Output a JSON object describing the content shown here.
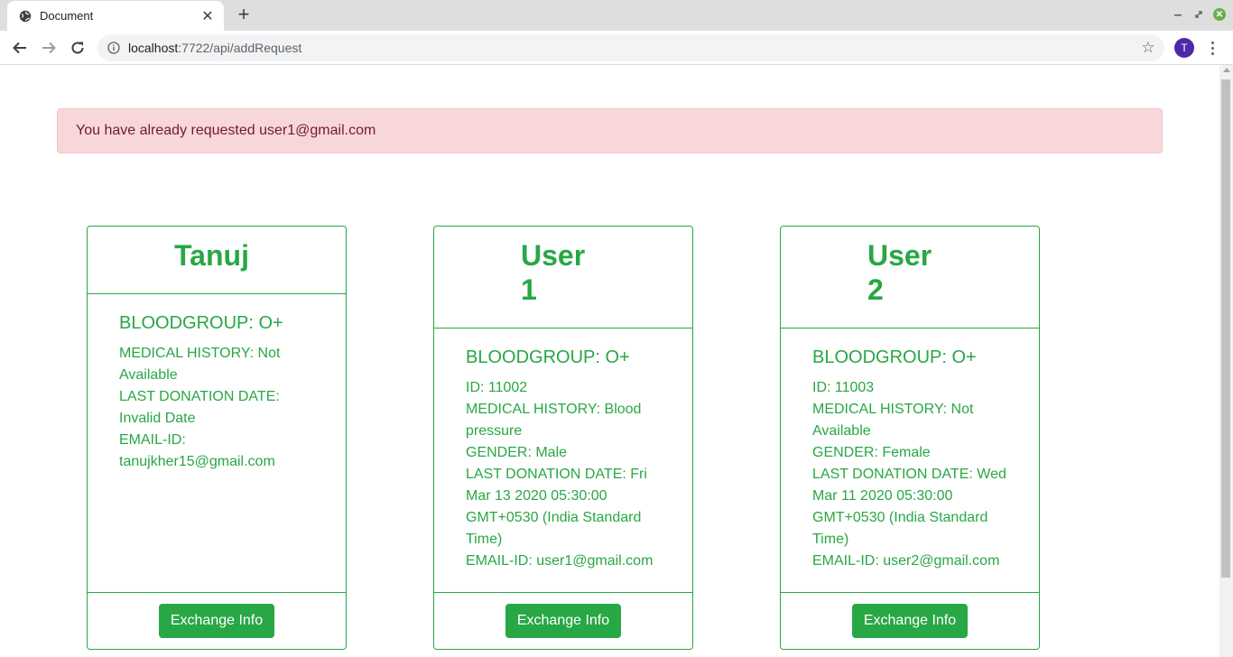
{
  "browser": {
    "tab_title": "Document",
    "url_host": "localhost",
    "url_rest": ":7722/api/addRequest",
    "profile_initial": "T"
  },
  "alert": {
    "message": "You have already requested user1@gmail.com"
  },
  "cards": [
    {
      "name": "Tanuj",
      "bloodgroup": "BLOODGROUP: O+",
      "lines": [
        "MEDICAL HISTORY: Not Available",
        "LAST DONATION DATE: Invalid Date",
        "EMAIL-ID: tanujkher15@gmail.com"
      ],
      "button": "Exchange Info"
    },
    {
      "name": "User 1",
      "bloodgroup": "BLOODGROUP: O+",
      "lines": [
        "ID: 11002",
        "MEDICAL HISTORY: Blood pressure",
        "GENDER: Male",
        "LAST DONATION DATE: Fri Mar 13 2020 05:30:00 GMT+0530 (India Standard Time)",
        "EMAIL-ID: user1@gmail.com"
      ],
      "button": "Exchange Info"
    },
    {
      "name": "User 2",
      "bloodgroup": "BLOODGROUP: O+",
      "lines": [
        "ID: 11003",
        "MEDICAL HISTORY: Not Available",
        "GENDER: Female",
        "LAST DONATION DATE: Wed Mar 11 2020 05:30:00 GMT+0530 (India Standard Time)",
        "EMAIL-ID: user2@gmail.com"
      ],
      "button": "Exchange Info"
    }
  ],
  "colors": {
    "accent": "#28a745",
    "alert_bg": "#f8d7da",
    "alert_text": "#721c24"
  }
}
